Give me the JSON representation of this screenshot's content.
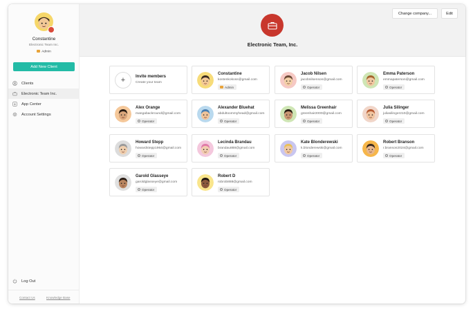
{
  "sidebar": {
    "user": {
      "name": "Constantine",
      "company": "Electronic Team Inc.",
      "role": "Admin"
    },
    "add_client_label": "Add New Client",
    "nav": [
      {
        "label": "Clients",
        "icon": "user-circle-icon"
      },
      {
        "label": "Electronic Team Inc.",
        "icon": "briefcase-icon"
      },
      {
        "label": "App Center",
        "icon": "download-icon"
      },
      {
        "label": "Account Settings",
        "icon": "gear-icon"
      }
    ],
    "logout_label": "Log Out",
    "footer": {
      "contact": "Contact Us",
      "kb": "Knowledge Base"
    }
  },
  "header": {
    "company_name": "Electronic Team, Inc.",
    "change_company_label": "Change company...",
    "edit_label": "Edit"
  },
  "invite": {
    "title": "Invite members",
    "subtitle": "Create your team"
  },
  "members": [
    {
      "name": "Constantine",
      "email": "kostenkokoss@gmail.com",
      "role": "Admin",
      "bg": "#f7dc7a",
      "skin": "#f2c896",
      "hair": "#3a2a20"
    },
    {
      "name": "Jacob Nilsen",
      "email": "jacobnilsenson@gmail.com",
      "role": "Operator",
      "bg": "#f6c9c4",
      "skin": "#f2cfa6",
      "hair": "#6b4a36"
    },
    {
      "name": "Emma Paterson",
      "email": "emmapaterson@gmail.com",
      "role": "Operator",
      "bg": "#cfe6b5",
      "skin": "#f0c7a0",
      "hair": "#a5642c"
    },
    {
      "name": "Alex Orange",
      "email": "mangabackround@gmail.com",
      "role": "Operator",
      "bg": "#f5c89a",
      "skin": "#d9a57a",
      "hair": "#2a1d14"
    },
    {
      "name": "Alexander Bluehat",
      "email": "abdultoommyhead@gmail.com",
      "role": "Operator",
      "bg": "#b9d9ee",
      "skin": "#efc39a",
      "hair": "#4b7fb0"
    },
    {
      "name": "Melissa Greenhair",
      "email": "greenhair2000@gmail.com",
      "role": "Operator",
      "bg": "#cfe6b5",
      "skin": "#c99673",
      "hair": "#2a1d14"
    },
    {
      "name": "Julia Silinger",
      "email": "juliasilinger210@gmail.com",
      "role": "Operator",
      "bg": "#f1d6c9",
      "skin": "#f0c4a0",
      "hair": "#b85c34"
    },
    {
      "name": "Howard Stepp",
      "email": "howardstepp1964@gmail.com",
      "role": "Operator",
      "bg": "#dcdcdc",
      "skin": "#f0cfae",
      "hair": "#9a9a9a"
    },
    {
      "name": "Lecinda Brandau",
      "email": "brandau888@gmail.com",
      "role": "Operator",
      "bg": "#f4c8dd",
      "skin": "#f2cdb0",
      "hair": "#e07aa8"
    },
    {
      "name": "Kate Blonderewski",
      "email": "k.blonderewski@gmail.com",
      "role": "Operator",
      "bg": "#c9c6f0",
      "skin": "#f0c8a2",
      "hair": "#e9c057"
    },
    {
      "name": "Robert Branson",
      "email": "r.branson2024@gmail.com",
      "role": "Operator",
      "bg": "#f6b64a",
      "skin": "#e7b68c",
      "hair": "#3a2a20"
    },
    {
      "name": "Garold Glasseye",
      "email": "garoldglasseye@gmail.com",
      "role": "Operator",
      "bg": "#e0e0e0",
      "skin": "#b98560",
      "hair": "#2a1d14"
    },
    {
      "name": "Robert D",
      "email": "robrob888@gmail.com",
      "role": "Operator",
      "bg": "#f9e58c",
      "skin": "#8a5a3c",
      "hair": "#1e1410"
    }
  ],
  "colors": {
    "accent": "#23bba6",
    "brand": "#c8372d"
  }
}
